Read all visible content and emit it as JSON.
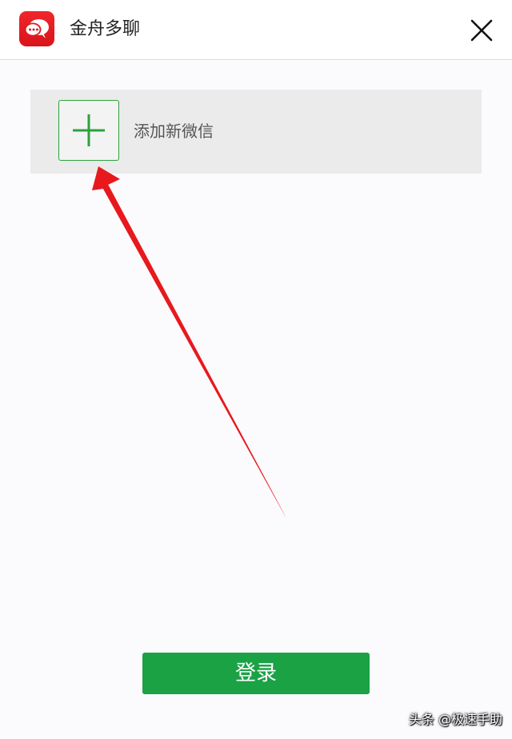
{
  "app": {
    "title": "金舟多聊",
    "logo_icon": "chat-bubble-icon"
  },
  "titlebar": {
    "close_icon": "close-icon"
  },
  "accounts": {
    "add_label": "添加新微信",
    "add_icon": "plus-icon"
  },
  "login": {
    "label": "登录"
  },
  "watermark": {
    "text": "头条 @极速手助"
  },
  "colors": {
    "brand_red": "#e01b21",
    "accent_green": "#1ba245",
    "annotation_red": "#e8191d"
  }
}
